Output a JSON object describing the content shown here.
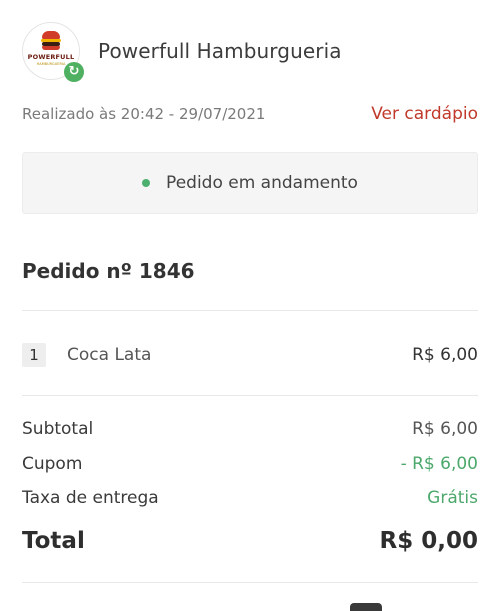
{
  "header": {
    "logo_text": "POWERFULL",
    "logo_subtext": "HAMBURGUERIA",
    "badge_icon": "refresh-icon",
    "store_name": "Powerfull Hamburgueria"
  },
  "order_meta": {
    "placed_at": "Realizado às 20:42 - 29/07/2021",
    "menu_link": "Ver cardápio",
    "menu_link_color": "#c0392b"
  },
  "status": {
    "text": "Pedido em andamento",
    "dot_color": "#4caf6d"
  },
  "order": {
    "title": "Pedido nº 1846",
    "items": [
      {
        "qty": "1",
        "name": "Coca Lata",
        "price": "R$ 6,00"
      }
    ]
  },
  "summary": {
    "subtotal_label": "Subtotal",
    "subtotal_value": "R$ 6,00",
    "coupon_label": "Cupom",
    "coupon_value": "- R$ 6,00",
    "delivery_label": "Taxa de entrega",
    "delivery_value": "Grátis",
    "total_label": "Total",
    "total_value": "R$ 0,00",
    "discount_color": "#4ca86b"
  }
}
